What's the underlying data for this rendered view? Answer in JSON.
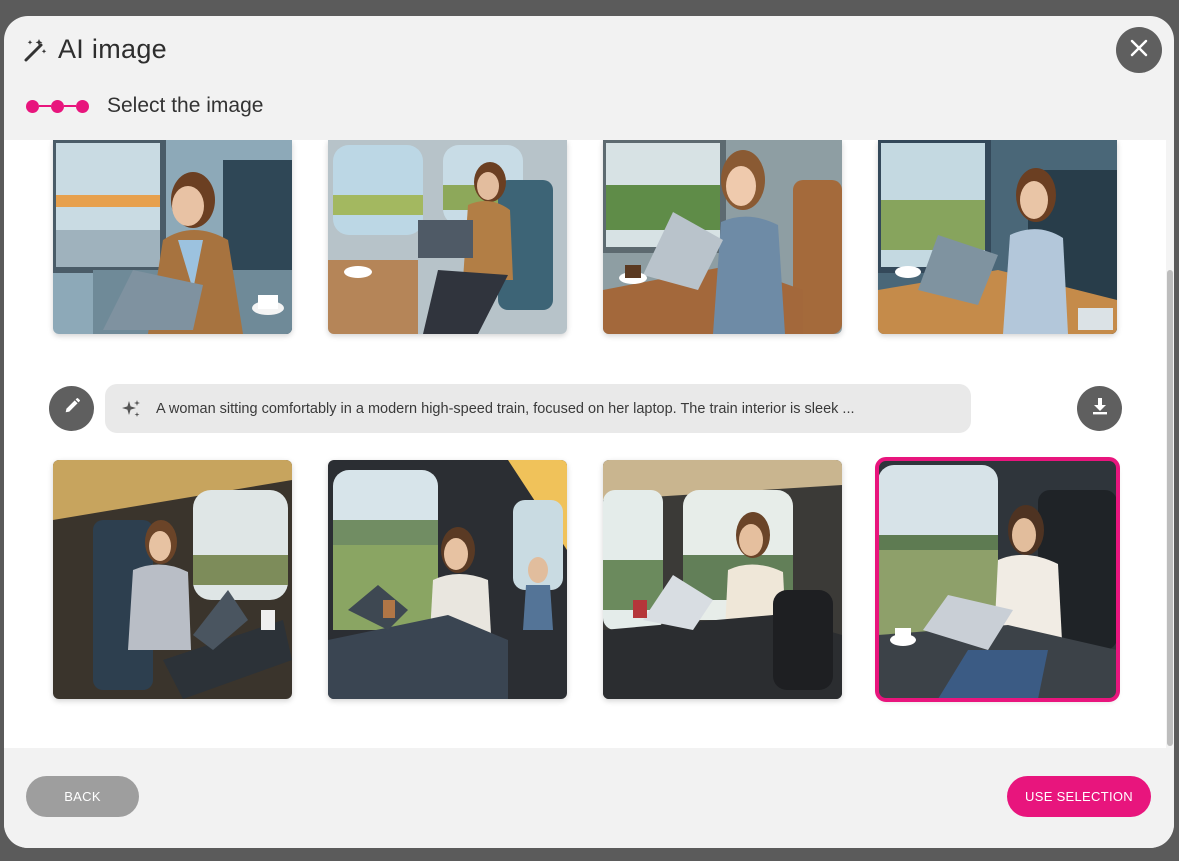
{
  "dialog": {
    "title": "AI image",
    "title_icon": "magic-wand-icon",
    "close_icon": "close-icon"
  },
  "stepper": {
    "label": "Select the image",
    "steps_total": 3,
    "steps_completed": 3,
    "accent_color": "#e8157d"
  },
  "gallery": {
    "top_row": [
      {
        "scene": "woman in brown blazer with laptop and coffee by train window"
      },
      {
        "scene": "woman in brown blazer with laptop in train seat"
      },
      {
        "scene": "woman in blue shirt with laptop at wooden train table"
      },
      {
        "scene": "woman in light shirt with laptop by train window"
      }
    ],
    "bottom_row": [
      {
        "scene": "woman in grey blazer with laptop and coffee cup"
      },
      {
        "scene": "woman in white shirt with laptop, passenger behind"
      },
      {
        "scene": "woman in cream shirt with laptop at train table"
      },
      {
        "scene": "woman in white blouse with laptop by window",
        "selected": true
      }
    ]
  },
  "prompt": {
    "text": "A woman sitting comfortably in a modern high-speed train, focused on her laptop. The train interior is sleek ...",
    "edit_icon": "pencil-icon",
    "sparkle_icon": "sparkle-icon",
    "download_icon": "download-icon"
  },
  "footer": {
    "back_label": "BACK",
    "use_label": "USE SELECTION"
  }
}
